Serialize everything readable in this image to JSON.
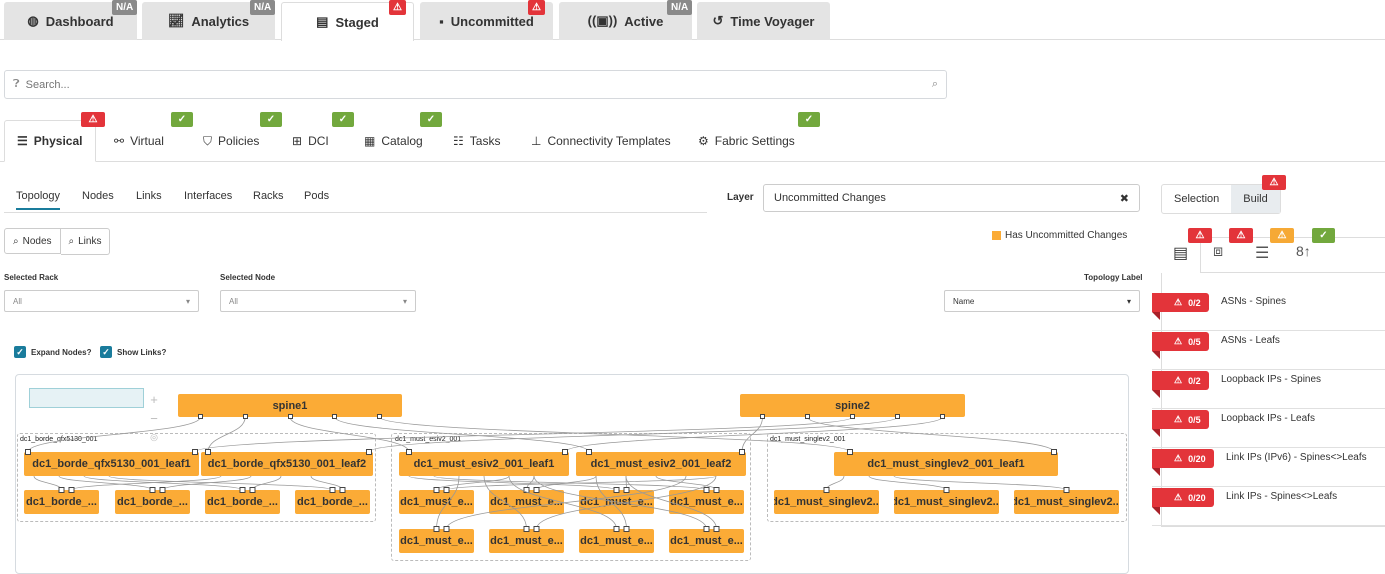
{
  "top_tabs": [
    {
      "label": "Dashboard",
      "icon": "dashboard-gauge-icon",
      "badge": "N/A"
    },
    {
      "label": "Analytics",
      "icon": "line-chart-icon",
      "badge": "N/A"
    },
    {
      "label": "Staged",
      "icon": "document-icon",
      "badge": "⚠",
      "active": true
    },
    {
      "label": "Uncommitted",
      "icon": "uncommitted-icon",
      "badge": "⚠"
    },
    {
      "label": "Active",
      "icon": "broadcast-icon",
      "badge": "N/A"
    },
    {
      "label": "Time Voyager",
      "icon": "history-icon"
    }
  ],
  "search": {
    "placeholder": "Search..."
  },
  "sub_tabs": [
    {
      "label": "Physical",
      "icon": "server-rack-icon",
      "status": "warning",
      "active": true
    },
    {
      "label": "Virtual",
      "icon": "network-icon",
      "status": "ok"
    },
    {
      "label": "Policies",
      "icon": "shield-icon",
      "status": "ok"
    },
    {
      "label": "DCI",
      "icon": "dci-icon",
      "status": "ok"
    },
    {
      "label": "Catalog",
      "icon": "catalog-icon",
      "status": "ok"
    },
    {
      "label": "Tasks",
      "icon": "list-icon"
    },
    {
      "label": "Connectivity Templates",
      "icon": "hierarchy-icon"
    },
    {
      "label": "Fabric Settings",
      "icon": "settings-icon",
      "status": "ok"
    }
  ],
  "view_tabs": [
    "Topology",
    "Nodes",
    "Links",
    "Interfaces",
    "Racks",
    "Pods"
  ],
  "layer": {
    "label": "Layer",
    "value": "Uncommitted Changes"
  },
  "legend": {
    "label": "Has Uncommitted Changes",
    "color": "#fbab36"
  },
  "buttons": {
    "nodes": "Nodes",
    "links": "Links"
  },
  "filters": {
    "rack": {
      "label": "Selected Rack",
      "value": "All"
    },
    "node": {
      "label": "Selected Node",
      "value": "All"
    },
    "topology_label": {
      "label": "Topology Label",
      "value": "Name"
    }
  },
  "checkboxes": {
    "expand": "Expand Nodes?",
    "show_links": "Show Links?"
  },
  "topology": {
    "spines": [
      "spine1",
      "spine2"
    ],
    "groups": [
      {
        "name": "dc1_borde_qfx5130_001",
        "leafs": [
          "dc1_borde_qfx5130_001_leaf1",
          "dc1_borde_qfx5130_001_leaf2"
        ],
        "servers": [
          "dc1_borde_...",
          "dc1_borde_...",
          "dc1_borde_...",
          "dc1_borde_..."
        ]
      },
      {
        "name": "dc1_must_esiv2_001",
        "leafs": [
          "dc1_must_esiv2_001_leaf1",
          "dc1_must_esiv2_001_leaf2"
        ],
        "servers": [
          "dc1_must_e...",
          "dc1_must_e...",
          "dc1_must_e...",
          "dc1_must_e...",
          "dc1_must_e...",
          "dc1_must_e...",
          "dc1_must_e...",
          "dc1_must_e..."
        ]
      },
      {
        "name": "dc1_must_singlev2_001",
        "leafs": [
          "dc1_must_singlev2_001_leaf1"
        ],
        "servers": [
          "dc1_must_singlev2...",
          "dc1_must_singlev2...",
          "dc1_must_singlev2..."
        ]
      }
    ]
  },
  "panel": {
    "toggle": [
      "Selection",
      "Build"
    ],
    "build_badge": "⚠",
    "tab_statuses": [
      "error",
      "error",
      "warning",
      "ok"
    ],
    "items": [
      {
        "count": "0/2",
        "label": "ASNs - Spines"
      },
      {
        "count": "0/5",
        "label": "ASNs - Leafs"
      },
      {
        "count": "0/2",
        "label": "Loopback IPs - Spines"
      },
      {
        "count": "0/5",
        "label": "Loopback IPs - Leafs"
      },
      {
        "count": "0/20",
        "label": "Link IPs (IPv6) - Spines<>Leafs"
      },
      {
        "count": "0/20",
        "label": "Link IPs - Spines<>Leafs"
      }
    ]
  }
}
